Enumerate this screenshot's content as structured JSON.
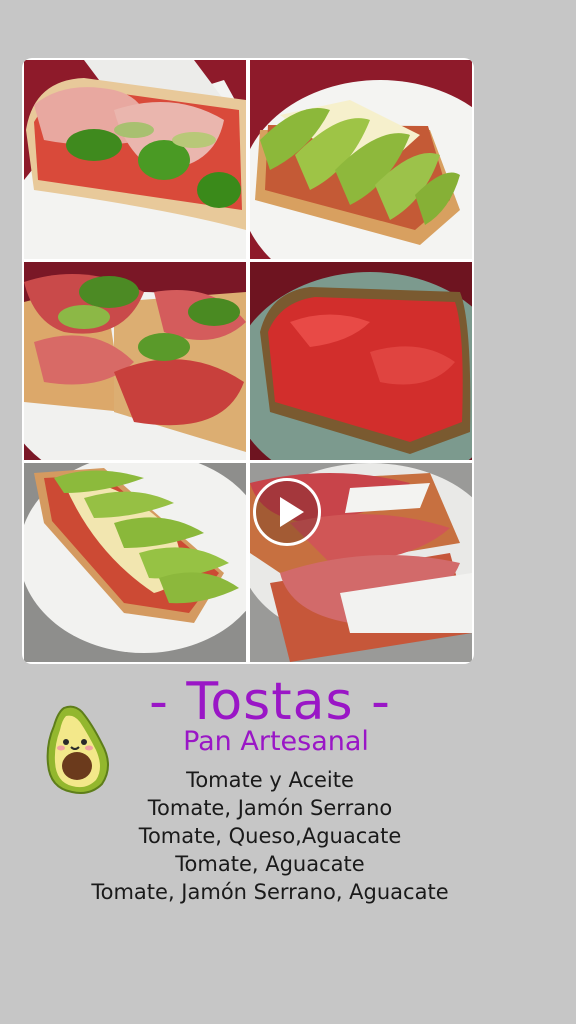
{
  "colors": {
    "background": "#c6c6c6",
    "title": "#9a16c6",
    "text": "#1a1a1a"
  },
  "collage": {
    "photos": [
      {
        "icon": "toast-ham-avocado-photo"
      },
      {
        "icon": "toast-cheese-avocado-photo"
      },
      {
        "icon": "toast-ham-plate-photo"
      },
      {
        "icon": "toast-tomato-photo"
      },
      {
        "icon": "toast-avocado-plate-photo"
      },
      {
        "icon": "toast-ham-cheese-video"
      }
    ],
    "play_icon": "play-icon"
  },
  "sticker": {
    "icon": "avocado-icon"
  },
  "title": "- Tostas -",
  "subtitle": "Pan Artesanal",
  "menu": {
    "items": [
      "Tomate y Aceite",
      "Tomate, Jamón Serrano",
      "Tomate, Queso,Aguacate",
      "Tomate, Aguacate",
      "Tomate, Jamón Serrano, Aguacate"
    ]
  }
}
